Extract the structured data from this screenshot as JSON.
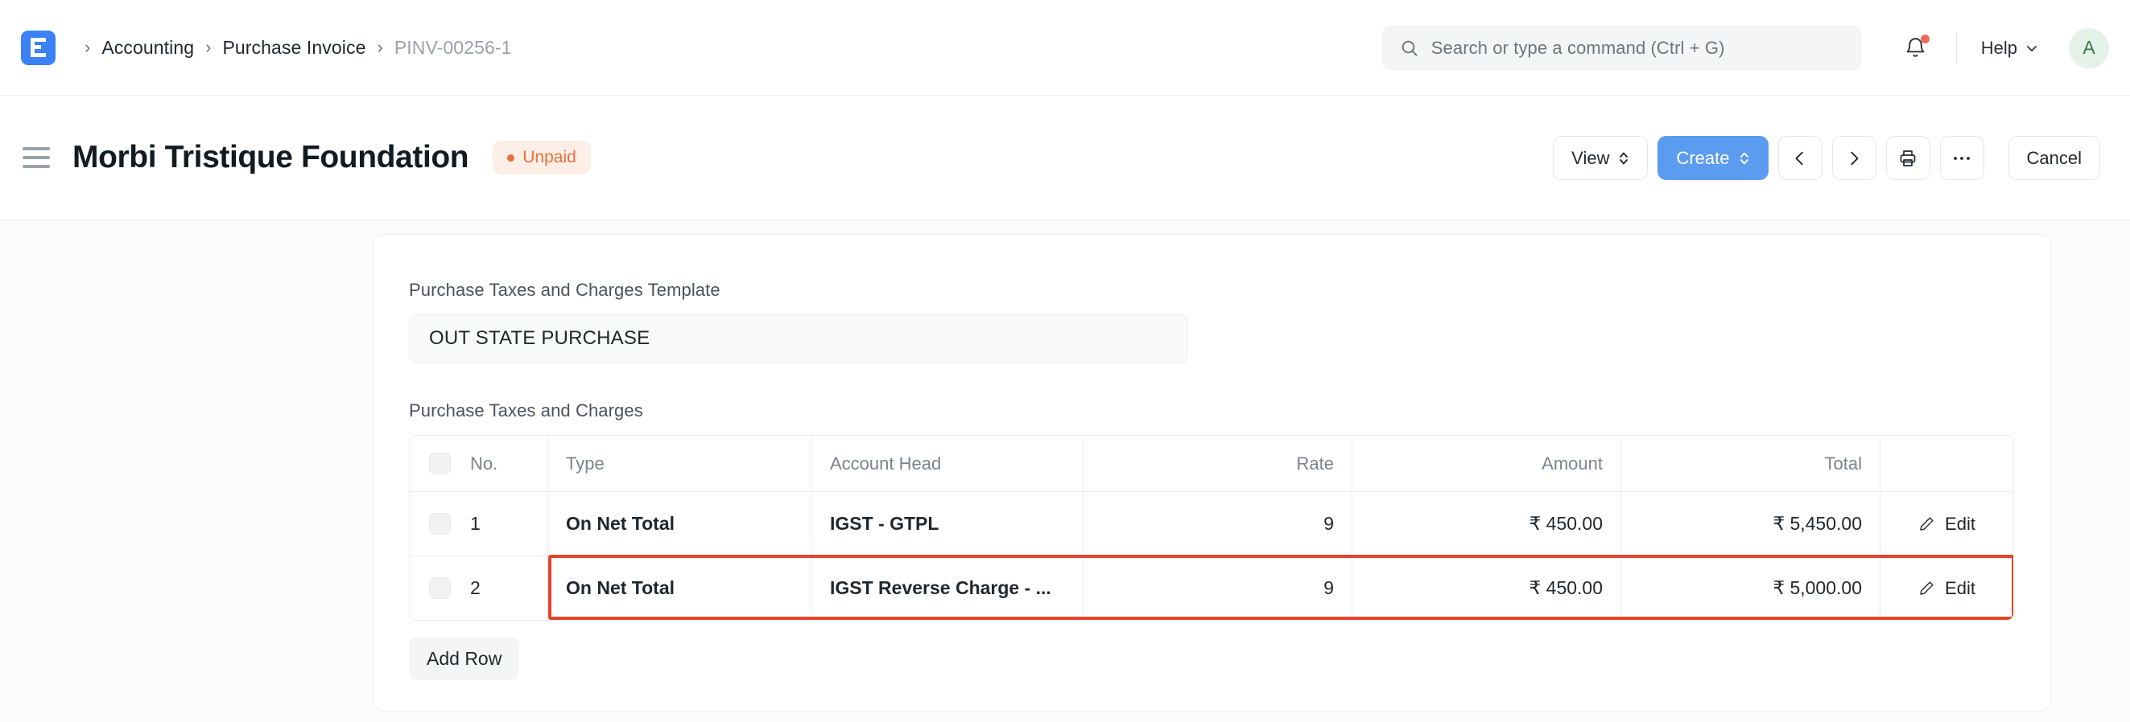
{
  "navbar": {
    "logo_icon": "erpnext-logo-icon",
    "breadcrumb": {
      "separator": "›",
      "items": [
        {
          "label": "Accounting",
          "current": false
        },
        {
          "label": "Purchase Invoice",
          "current": false
        },
        {
          "label": "PINV-00256-1",
          "current": true
        }
      ]
    },
    "search": {
      "icon": "search-icon",
      "placeholder": "Search or type a command (Ctrl + G)",
      "value": ""
    },
    "notifications": {
      "icon": "bell-icon",
      "has_unread": true,
      "dot_color": "#f06b5c"
    },
    "help": {
      "label": "Help",
      "icon": "chevron-down-icon"
    },
    "avatar": {
      "initial": "A",
      "bg_color": "#e4f2e7",
      "text_color": "#2e7d4f"
    }
  },
  "page_head": {
    "menu_icon": "hamburger-menu-icon",
    "title": "Morbi Tristique Foundation",
    "status": {
      "label": "Unpaid",
      "color": "#e8703a",
      "bg": "#fdeee7"
    },
    "actions": {
      "view_label": "View",
      "create_label": "Create",
      "prev_icon": "chevron-left-icon",
      "next_icon": "chevron-right-icon",
      "print_icon": "printer-icon",
      "more_icon": "ellipsis-icon",
      "cancel_label": "Cancel"
    }
  },
  "form": {
    "template_field": {
      "label": "Purchase Taxes and Charges Template",
      "value": "OUT STATE PURCHASE"
    },
    "grid": {
      "label": "Purchase Taxes and Charges",
      "columns": [
        "No.",
        "Type",
        "Account Head",
        "Rate",
        "Amount",
        "Total"
      ],
      "action_column": "",
      "rows": [
        {
          "no": "1",
          "type": "On Net Total",
          "account_head": "IGST - GTPL",
          "rate": "9",
          "amount": "₹ 450.00",
          "total": "₹ 5,450.00",
          "edit_label": "Edit",
          "highlighted": false
        },
        {
          "no": "2",
          "type": "On Net Total",
          "account_head": "IGST Reverse Charge - ...",
          "rate": "9",
          "amount": "₹ 450.00",
          "total": "₹ 5,000.00",
          "edit_label": "Edit",
          "highlighted": true
        }
      ],
      "add_row_label": "Add Row",
      "highlight_color": "#e8442a"
    }
  }
}
